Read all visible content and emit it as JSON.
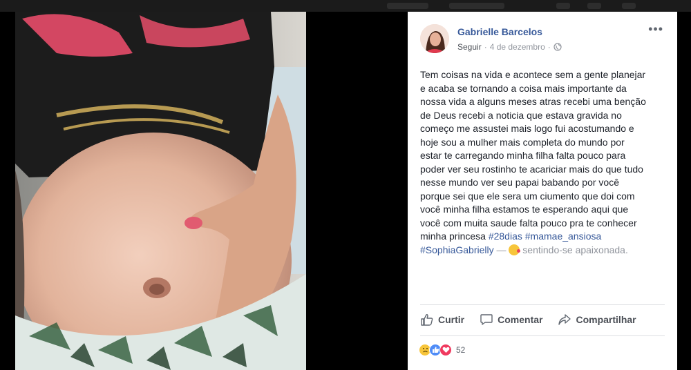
{
  "topbar": {
    "visible": true
  },
  "photo": {
    "alt": "",
    "icon": "post-photo"
  },
  "post": {
    "author": "Gabrielle Barcelos",
    "follow_label": "Seguir",
    "separator": "·",
    "date": "4 de dezembro",
    "privacy_icon": "globe-icon",
    "more_label": "•••",
    "text_lines": [
      "Tem coisas na vida e acontece sem a gente planejar",
      "e acaba se tornando a coisa mais importante da",
      "nossa vida a alguns meses atras recebi uma benção",
      "de Deus recebi a noticia que estava gravida no",
      "começo me assustei mais logo fui acostumando e",
      "hoje sou a mulher mais completa do mundo por",
      "estar te carregando minha filha falta pouco para",
      "poder ver seu rostinho te acariciar mais do que tudo",
      "nesse mundo ver seu papai babando por você",
      "porque sei que ele sera um ciumento que doi com",
      "você minha filha estamos te esperando aqui que",
      "você com muita saude falta pouco pra te conhecer"
    ],
    "last_line_prefix": "minha princesa",
    "hashtag_1": "#28dias",
    "hashtag_2": "#mamae_ansiosa",
    "hashtag_3": "#SophiaGabrielly",
    "dash": "—",
    "feeling_emoji": "smiling-face-with-heart-icon",
    "feeling_text": "sentindo-se apaixonada."
  },
  "actions": {
    "like_label": "Curtir",
    "comment_label": "Comentar",
    "share_label": "Compartilhar"
  },
  "reactions": {
    "icons": [
      "sad-reaction-icon",
      "like-reaction-icon",
      "love-reaction-icon"
    ],
    "count": "52"
  },
  "colors": {
    "link": "#365899",
    "text": "#1d2129",
    "meta": "#90949c",
    "like_blue": "#4f8cf7",
    "love_red": "#f03a5f",
    "sad_yellow": "#f7c53b"
  }
}
